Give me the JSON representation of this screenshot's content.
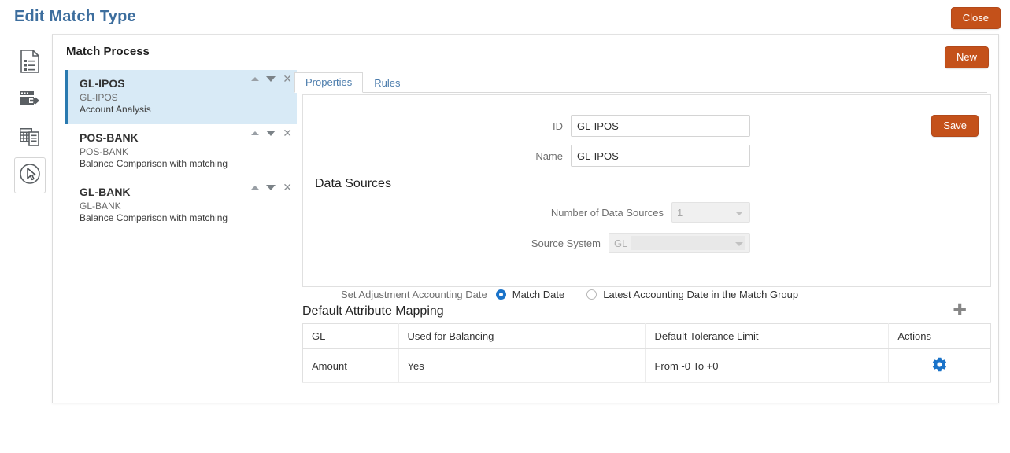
{
  "header": {
    "title": "Edit Match Type",
    "close_label": "Close",
    "title_color": "#3d6e9e",
    "button_color": "#c4511a"
  },
  "rail": {
    "items": [
      {
        "icon": "document-list-icon",
        "name": "rail-item-document-list",
        "selected": false
      },
      {
        "icon": "data-load-icon",
        "name": "rail-item-data-load",
        "selected": false
      },
      {
        "icon": "report-grid-icon",
        "name": "rail-item-report-grid",
        "selected": false
      },
      {
        "icon": "cursor-pointer-icon",
        "name": "rail-item-match-type",
        "selected": true
      }
    ]
  },
  "card": {
    "heading": "Match Process",
    "new_label": "New"
  },
  "process_list": [
    {
      "name": "GL-IPOS",
      "sub": "GL-IPOS",
      "desc": "Account Analysis",
      "selected": true
    },
    {
      "name": "POS-BANK",
      "sub": "POS-BANK",
      "desc": "Balance Comparison with matching",
      "selected": false
    },
    {
      "name": "GL-BANK",
      "sub": "GL-BANK",
      "desc": "Balance Comparison with matching",
      "selected": false
    }
  ],
  "tabs": [
    {
      "label": "Properties",
      "active": true
    },
    {
      "label": "Rules",
      "active": false
    }
  ],
  "properties": {
    "save_label": "Save",
    "id_label": "ID",
    "id_value": "GL-IPOS",
    "name_label": "Name",
    "name_value": "GL-IPOS",
    "data_sources_heading": "Data Sources",
    "number_of_data_sources_label": "Number of Data Sources",
    "number_of_data_sources_value": "1",
    "source_system_label": "Source System",
    "source_system_value": "GL",
    "set_adjustment_label": "Set Adjustment Accounting Date",
    "radio_match_date": "Match Date",
    "radio_latest_date": "Latest Accounting Date in the Match Group",
    "radio_selected": "Match Date"
  },
  "attribute_mapping": {
    "title": "Default Attribute Mapping",
    "add_icon": "plus-icon",
    "columns": [
      "GL",
      "Used for Balancing",
      "Default Tolerance Limit",
      "Actions"
    ],
    "rows": [
      {
        "gl": "Amount",
        "used_for_balancing": "Yes",
        "default_tolerance_limit": "From -0 To +0",
        "action_icon": "gear-icon"
      }
    ]
  }
}
